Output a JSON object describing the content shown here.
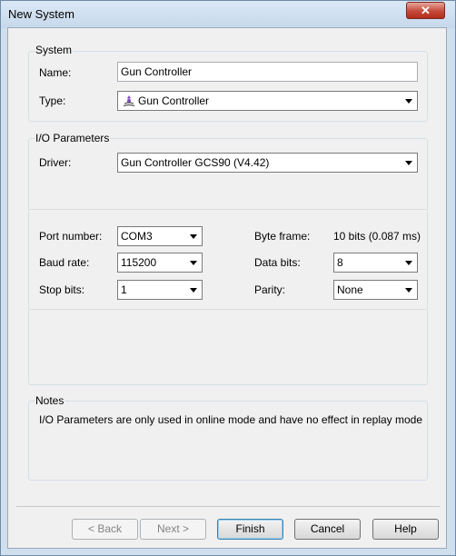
{
  "window": {
    "title": "New System",
    "close_glyph": "✕"
  },
  "system": {
    "legend": "System",
    "name_label": "Name:",
    "name_value": "Gun Controller",
    "type_label": "Type:",
    "type_value": "Gun Controller",
    "type_icon": "gun-controller-icon"
  },
  "io": {
    "legend": "I/O Parameters",
    "driver_label": "Driver:",
    "driver_value": "Gun Controller GCS90 (V4.42)",
    "port_label": "Port number:",
    "port_value": "COM3",
    "baud_label": "Baud rate:",
    "baud_value": "115200",
    "stop_label": "Stop bits:",
    "stop_value": "1",
    "byte_frame_label": "Byte frame:",
    "byte_frame_value": "10 bits (0.087 ms)",
    "data_bits_label": "Data bits:",
    "data_bits_value": "8",
    "parity_label": "Parity:",
    "parity_value": "None"
  },
  "notes": {
    "legend": "Notes",
    "text": "I/O Parameters are only used in online mode and have no effect in replay mode"
  },
  "buttons": {
    "back": "< Back",
    "next": "Next >",
    "finish": "Finish",
    "cancel": "Cancel",
    "help": "Help"
  },
  "colors": {
    "close_red": "#c4493a",
    "default_button_border": "#3c7fb1",
    "frame": "#cfdfee"
  }
}
